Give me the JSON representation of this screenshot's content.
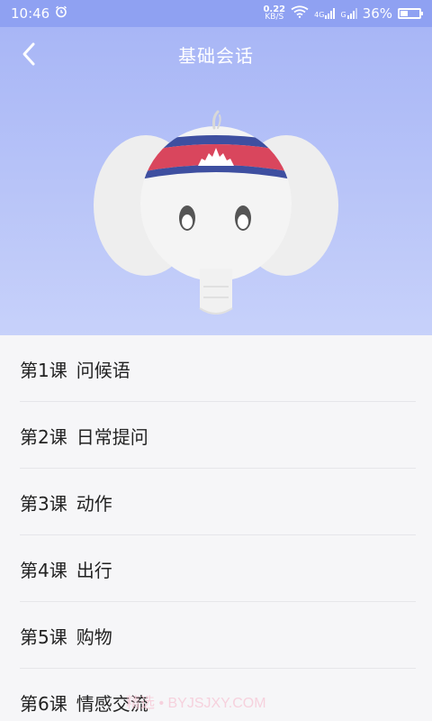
{
  "status_bar": {
    "time": "10:46",
    "net_speed_value": "0.22",
    "net_speed_unit": "KB/S",
    "signal1_label": "4G",
    "signal2_label": "G",
    "battery": "36%",
    "battery_level": 0.36
  },
  "header": {
    "title": "基础会话"
  },
  "lessons": [
    {
      "number": "第1课",
      "name": "问候语"
    },
    {
      "number": "第2课",
      "name": "日常提问"
    },
    {
      "number": "第3课",
      "name": "动作"
    },
    {
      "number": "第4课",
      "name": "出行"
    },
    {
      "number": "第5课",
      "name": "购物"
    },
    {
      "number": "第6课",
      "name": "情感交流"
    }
  ],
  "watermark": "精选 • BYJSJXY.COM",
  "colors": {
    "accent": "#8fa1f2",
    "flag_red": "#d9465d",
    "flag_blue": "#3e4fa0"
  }
}
